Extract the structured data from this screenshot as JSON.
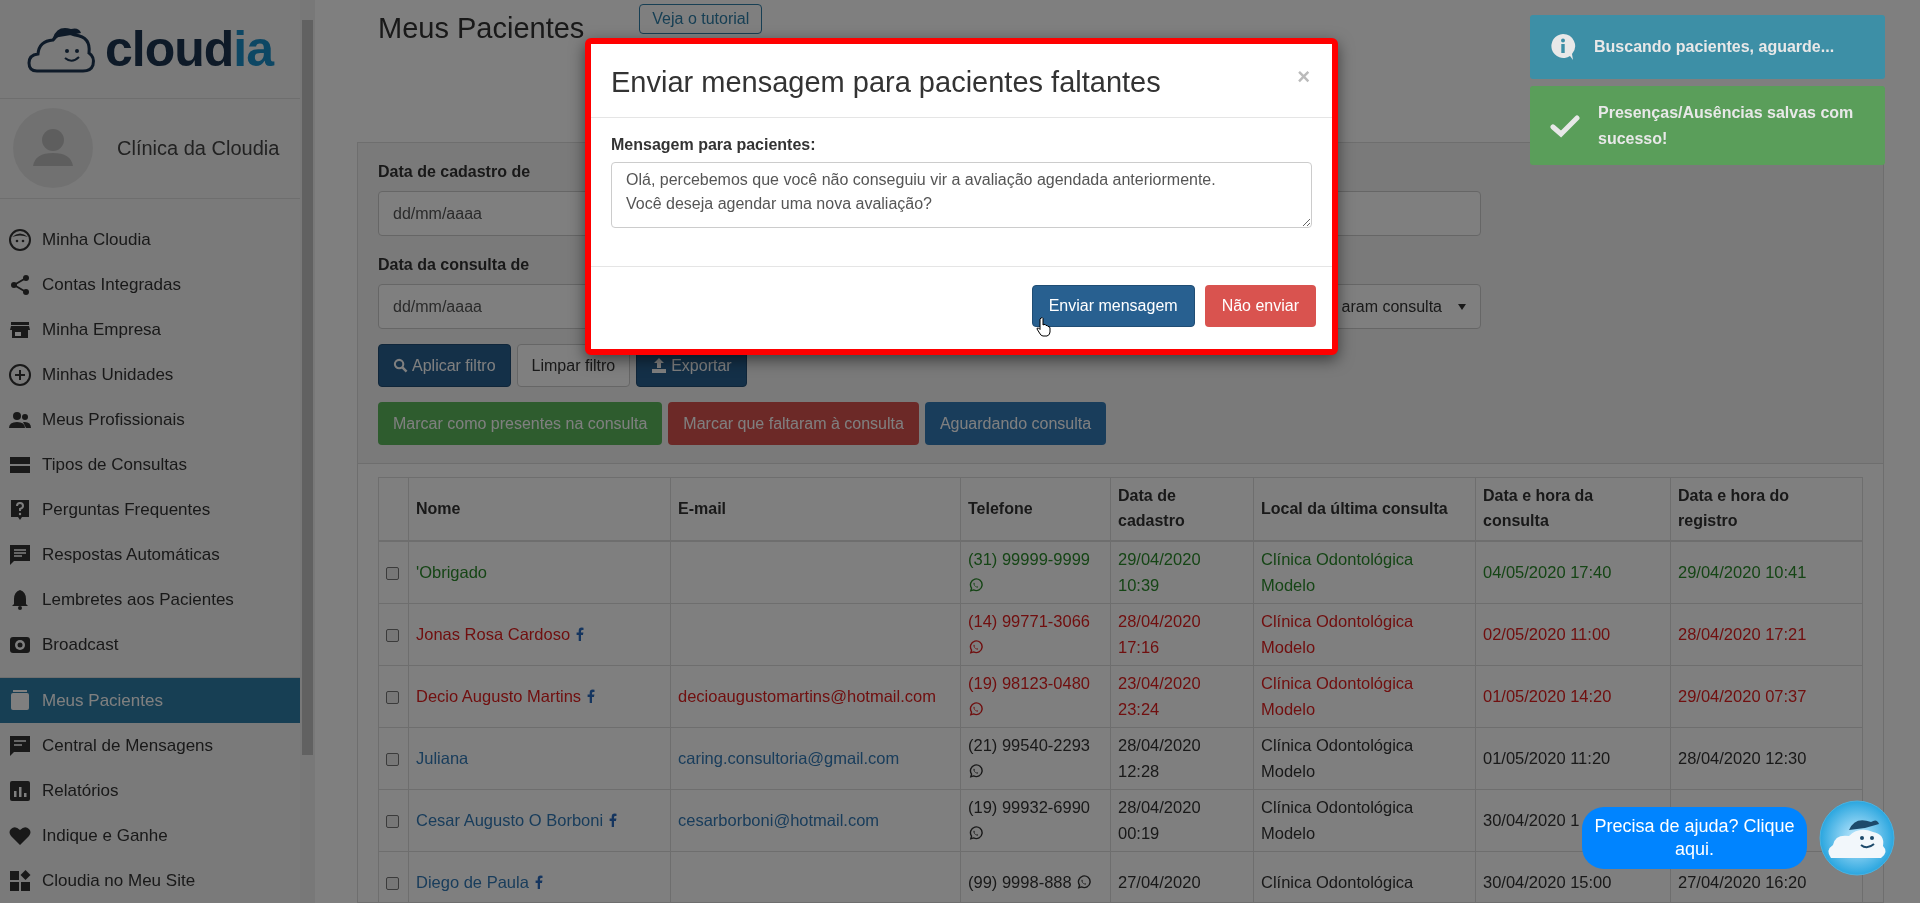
{
  "logo": {
    "text_dark": "cloud",
    "text_accent": "ia"
  },
  "profile": {
    "name": "Clínica da Cloudia"
  },
  "sidebar": {
    "items": [
      {
        "label": "Minha Cloudia",
        "selected": false
      },
      {
        "label": "Contas Integradas",
        "selected": false
      },
      {
        "label": "Minha Empresa",
        "selected": false
      },
      {
        "label": "Minhas Unidades",
        "selected": false
      },
      {
        "label": "Meus Profissionais",
        "selected": false
      },
      {
        "label": "Tipos de Consultas",
        "selected": false
      },
      {
        "label": "Perguntas Frequentes",
        "selected": false
      },
      {
        "label": "Respostas Automáticas",
        "selected": false
      },
      {
        "label": "Lembretes aos Pacientes",
        "selected": false
      },
      {
        "label": "Broadcast",
        "selected": false
      },
      {
        "label": "Meus Pacientes",
        "selected": true
      },
      {
        "label": "Central de Mensagens",
        "selected": false
      },
      {
        "label": "Relatórios",
        "selected": false
      },
      {
        "label": "Indique e Ganhe",
        "selected": false
      },
      {
        "label": "Cloudia no Meu Site",
        "selected": false
      }
    ]
  },
  "page": {
    "title": "Meus Pacientes",
    "tutorial_button": "Veja o tutorial"
  },
  "filters": {
    "registration_label": "Data de cadastro de",
    "registration_placeholder": "dd/mm/aaaa",
    "consult_label": "Data da consulta de",
    "consult_placeholder": "dd/mm/aaaa",
    "status_select": "aram consulta"
  },
  "filter_buttons": [
    {
      "label": "Aplicar filtro",
      "kind": "primary"
    },
    {
      "label": "Limpar filtro",
      "kind": "default"
    },
    {
      "label": "Exportar",
      "kind": "export"
    }
  ],
  "mark_buttons": [
    {
      "label": "Marcar como presentes na consulta",
      "kind": "present"
    },
    {
      "label": "Marcar que faltaram à consulta",
      "kind": "absent"
    },
    {
      "label": "Aguardando consulta",
      "kind": "waiting"
    }
  ],
  "table": {
    "columns": [
      "Nome",
      "E-mail",
      "Telefone",
      "Data de cadastro",
      "Local da última consulta",
      "Data e hora da consulta",
      "Data e hora do registro"
    ],
    "rows": [
      {
        "kind": "present",
        "checked": false,
        "name": "'Obrigado",
        "facebook": false,
        "phone": "(31) 99999-9999",
        "whatsapp": true,
        "registered": "29/04/2020 10:39",
        "location": "Clínica Odontológica Modelo",
        "consult": "04/05/2020 17:40",
        "record": "29/04/2020 10:41"
      },
      {
        "kind": "absent",
        "checked": false,
        "name": "Jonas Rosa Cardoso",
        "facebook": true,
        "phone": "(14) 99771-3066",
        "whatsapp": true,
        "registered": "28/04/2020 17:16",
        "location": "Clínica Odontológica Modelo",
        "consult": "02/05/2020 11:00",
        "record": "28/04/2020 17:21"
      },
      {
        "kind": "absent",
        "checked": false,
        "name": "Decio Augusto Martins",
        "facebook": true,
        "email": "decioaugustomartins@hotmail.com",
        "phone": "(19) 98123-0480",
        "whatsapp": true,
        "registered": "23/04/2020 23:24",
        "location": "Clínica Odontológica Modelo",
        "consult": "01/05/2020 14:20",
        "record": "29/04/2020 07:37"
      },
      {
        "kind": "waiting",
        "checked": false,
        "name": "Juliana",
        "facebook": false,
        "email": "caring.consultoria@gmail.com",
        "phone": "(21) 99540-2293",
        "whatsapp": true,
        "registered": "28/04/2020 12:28",
        "location": "Clínica Odontológica Modelo",
        "consult": "01/05/2020 11:20",
        "record": "28/04/2020 12:30"
      },
      {
        "kind": "waiting",
        "checked": false,
        "name": "Cesar Augusto O Borboni",
        "facebook": true,
        "email": "cesarborboni@hotmail.com",
        "phone": "(19) 99932-6990",
        "whatsapp": true,
        "registered": "28/04/2020 00:19",
        "location": "Clínica Odontológica Modelo",
        "consult": "30/04/2020 1"
      },
      {
        "kind": "waiting",
        "checked": false,
        "name": "Diego de Paula",
        "facebook": true,
        "phone": "(99) 9998-888",
        "whatsapp": true,
        "registered": "27/04/2020",
        "location": "Clínica Odontológica",
        "consult": "30/04/2020 15:00",
        "record": "27/04/2020 16:20"
      }
    ]
  },
  "modal": {
    "title": "Enviar mensagem para pacientes faltantes",
    "close": "×",
    "message_label": "Mensagem para pacientes:",
    "message": "Olá, percebemos que você não conseguiu vir a avaliação agendada anteriormente.\nVocê deseja agendar uma nova avaliação?",
    "buttons": [
      {
        "label": "Enviar mensagem",
        "kind": "primary"
      },
      {
        "label": "Não enviar",
        "kind": "danger"
      }
    ]
  },
  "toasts": [
    {
      "kind": "info",
      "text": "Buscando pacientes, aguarde..."
    },
    {
      "kind": "success",
      "text": "Presenças/Ausências salvas com sucesso!"
    }
  ],
  "help_bubble": {
    "text": "Precisa de ajuda? Clique aqui."
  }
}
